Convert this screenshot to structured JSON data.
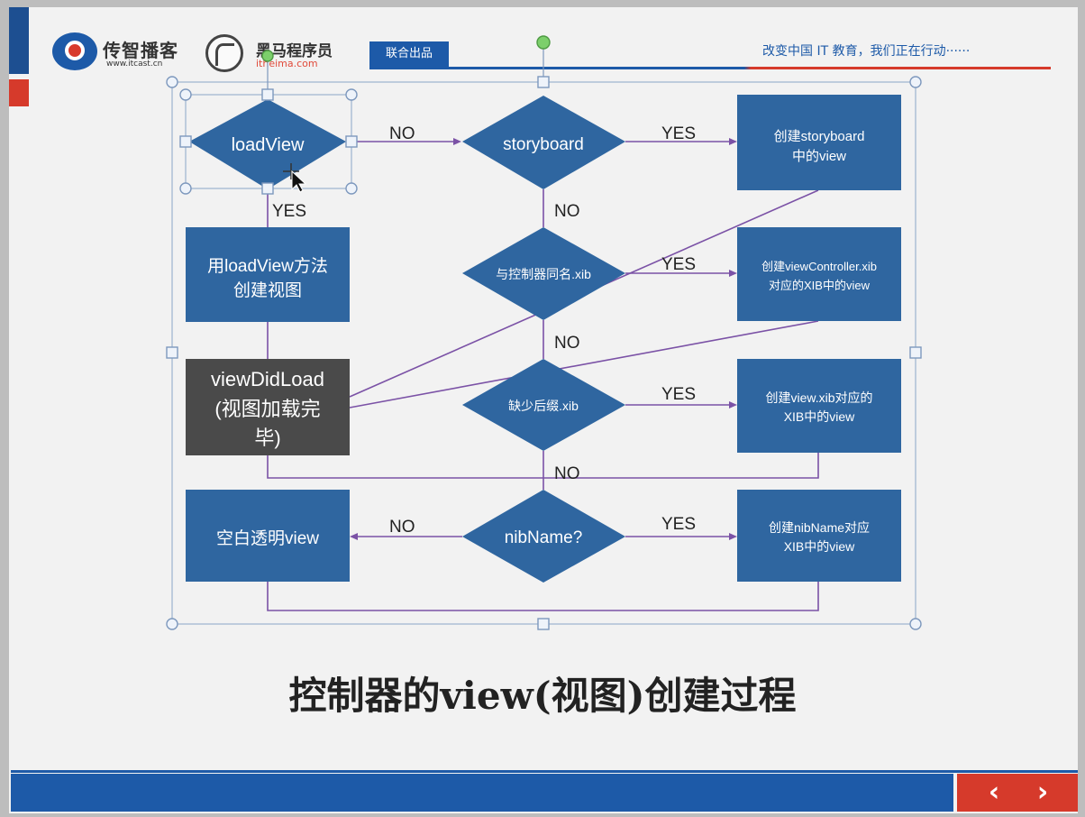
{
  "header": {
    "logo1_name": "传智播客",
    "logo1_url": "www.itcast.cn",
    "logo2_name": "黑马程序员",
    "logo2_url": "itheima.com",
    "badge": "联合出品",
    "slogan": "改变中国 IT 教育，我们正在行动······"
  },
  "diagram": {
    "decisions": {
      "loadview": "loadView",
      "storyboard": "storyboard",
      "same_name_xib": "与控制器同名.xib",
      "missing_suffix_xib": "缺少后缀.xib",
      "nibname": "nibName?"
    },
    "boxes": {
      "use_loadview": [
        "用loadView方法",
        "创建视图"
      ],
      "viewdidload": [
        "viewDidLoad",
        "(视图加载完",
        "毕)"
      ],
      "blank_view": [
        "空白透明view"
      ],
      "create_storyboard": [
        "创建storyboard",
        "中的view"
      ],
      "create_vc_xib": [
        "创建viewController.xib",
        "对应的XIB中的view"
      ],
      "create_view_xib": [
        "创建view.xib对应的",
        "XIB中的view"
      ],
      "create_nibname": [
        "创建nibName对应",
        "XIB中的view"
      ]
    },
    "edge_labels": {
      "loadview_no": "NO",
      "loadview_yes": "YES",
      "storyboard_yes": "YES",
      "storyboard_no": "NO",
      "same_name_yes": "YES",
      "same_name_no": "NO",
      "missing_suffix_yes": "YES",
      "missing_suffix_no": "NO",
      "nibname_no": "NO",
      "nibname_yes": "YES"
    },
    "colors": {
      "shape_fill": "#2f66a0",
      "dark_fill": "#4a4a4a",
      "connector": "#7b52a6",
      "selection": "#9db3cf"
    }
  },
  "caption": "控制器的view(视图)创建过程",
  "nav": {
    "prev": "‹",
    "next": "›"
  }
}
